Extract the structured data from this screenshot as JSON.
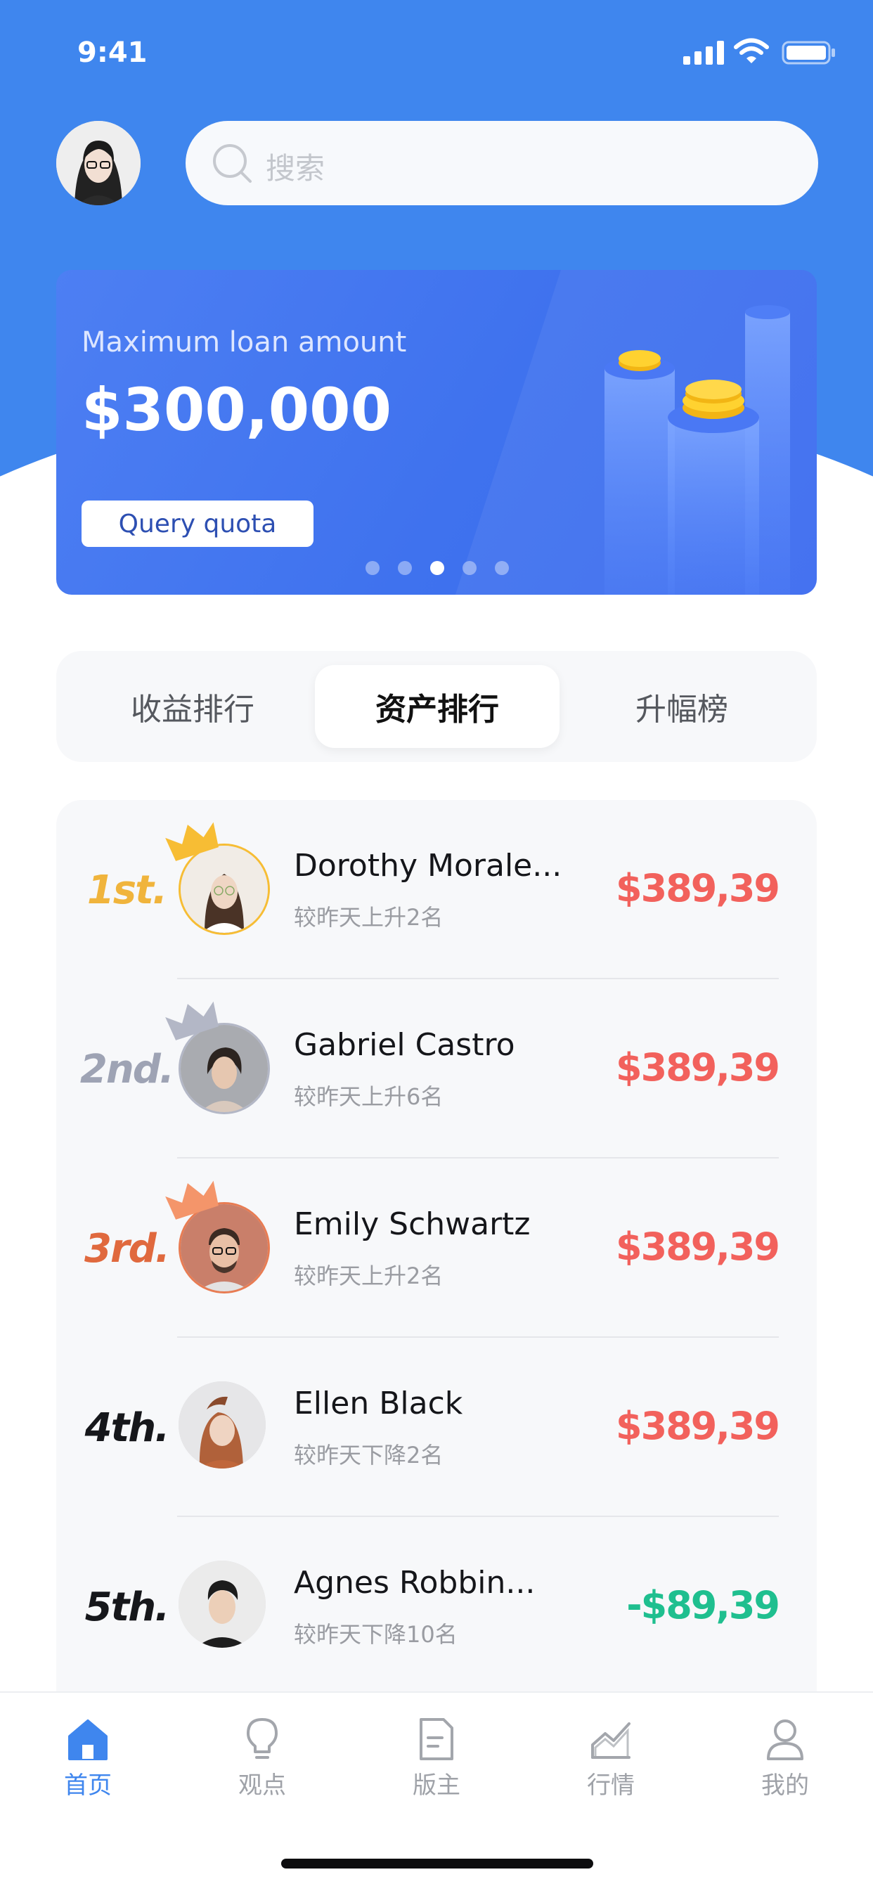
{
  "status_bar": {
    "time": "9:41"
  },
  "search": {
    "placeholder": "搜索"
  },
  "banner": {
    "subtitle": "Maximum loan amount",
    "amount": "$300,000",
    "button_label": "Query quota",
    "slide_count": 5,
    "active_slide": 3
  },
  "tabs": [
    {
      "label": "收益排行",
      "active": false
    },
    {
      "label": "资产排行",
      "active": true
    },
    {
      "label": "升幅榜",
      "active": false
    }
  ],
  "rankings": [
    {
      "rank": "1st.",
      "name": "Dorothy Morale...",
      "change": "较昨天上升2名",
      "value": "$389,39",
      "value_color": "#f2615c",
      "rank_color": "#f0b43c",
      "crown_color": "#f7bd34",
      "ring_color": "#f7bd34"
    },
    {
      "rank": "2nd.",
      "name": "Gabriel Castro",
      "change": "较昨天上升6名",
      "value": "$389,39",
      "value_color": "#f2615c",
      "rank_color": "#9ea3b4",
      "crown_color": "#b3b7c6",
      "ring_color": "#b3b7c6"
    },
    {
      "rank": "3rd.",
      "name": "Emily Schwartz",
      "change": "较昨天上升2名",
      "value": "$389,39",
      "value_color": "#f2615c",
      "rank_color": "#e0693e",
      "crown_color": "#f4956a",
      "ring_color": "#e87c53"
    },
    {
      "rank": "4th.",
      "name": "Ellen Black",
      "change": "较昨天下降2名",
      "value": "$389,39",
      "value_color": "#f2615c",
      "rank_color": "#16171b"
    },
    {
      "rank": "5th.",
      "name": "Agnes Robbin...",
      "change": "较昨天下降10名",
      "value": "-$89,39",
      "value_color": "#1fbf8f",
      "rank_color": "#16171b"
    }
  ],
  "tabbar": [
    {
      "label": "首页",
      "icon": "home-icon",
      "active": true
    },
    {
      "label": "观点",
      "icon": "lightbulb-icon",
      "active": false
    },
    {
      "label": "版主",
      "icon": "document-icon",
      "active": false
    },
    {
      "label": "行情",
      "icon": "chart-icon",
      "active": false
    },
    {
      "label": "我的",
      "icon": "profile-icon",
      "active": false
    }
  ],
  "colors": {
    "brand_blue": "#3f86ee",
    "positive_red": "#f2615c",
    "negative_green": "#1fbf8f"
  }
}
